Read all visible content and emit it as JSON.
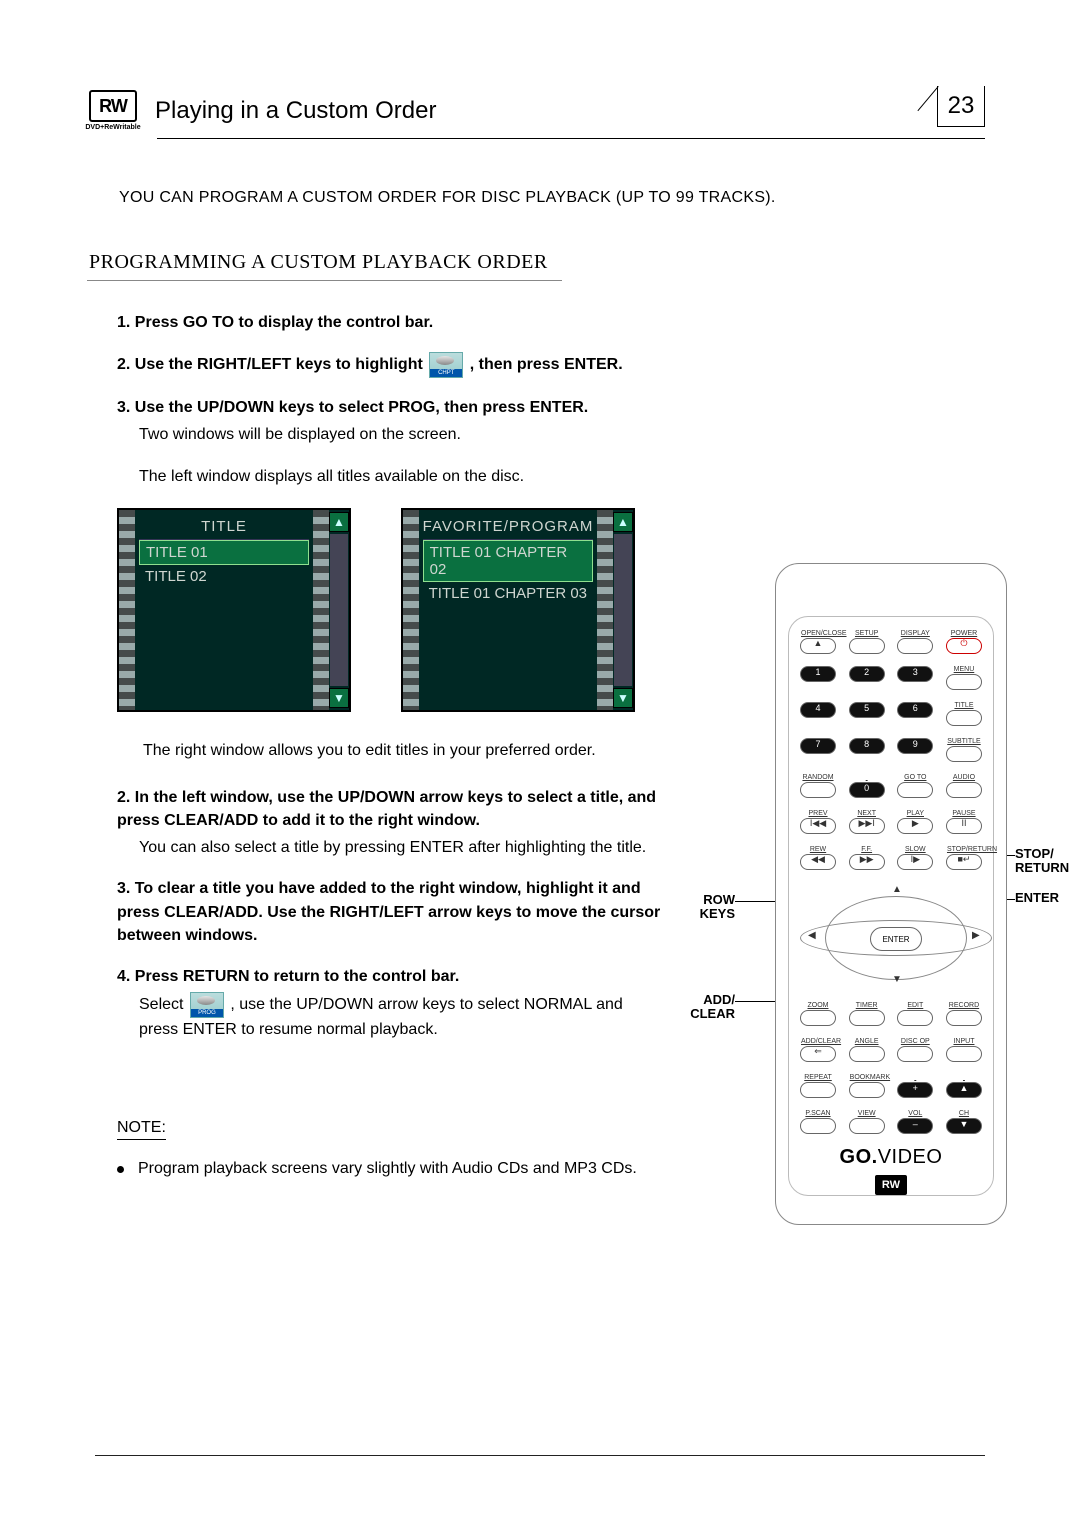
{
  "header": {
    "rw_text": "RW",
    "rw_sub": "DVD+ReWritable",
    "title": "Playing in a Custom Order",
    "page_number": "23"
  },
  "intro": "YOU CAN PROGRAM A CUSTOM ORDER FOR DISC PLAYBACK (UP TO 99 TRACKS).",
  "section_heading": "PROGRAMMING A CUSTOM PLAYBACK ORDER",
  "steps_a": {
    "s1": "1. Press GO TO to display  the control bar.",
    "s2a": "2. Use the RIGHT/LEFT keys to highlight",
    "s2b": ", then press ENTER.",
    "s3a": "3. Use the UP/DOWN keys to select PROG, then press ENTER.",
    "s3b": "Two windows will be displayed on the screen.",
    "caption_left": "The left window displays all titles available on the disc."
  },
  "windows": {
    "left": {
      "title": "TITLE",
      "rows": [
        "TITLE 01",
        "TITLE 02"
      ]
    },
    "right": {
      "title": "FAVORITE/PROGRAM",
      "rows": [
        "TITLE 01 CHAPTER 02",
        "TITLE 01 CHAPTER 03"
      ]
    }
  },
  "caption_right": "The right window allows you to edit titles in your preferred order.",
  "steps_b": {
    "s2a": "2. In the left window, use the UP/DOWN arrow keys to select a title, and press CLEAR/ADD to add it to the right window.",
    "s2b": "You can also select a title by pressing ENTER after highlighting the title.",
    "s3": "3. To clear a title you have added to the right window, highlight it and press CLEAR/ADD. Use the RIGHT/LEFT arrow keys to move the cursor between windows.",
    "s4": "4. Press RETURN to return to the control bar.",
    "s4suba": "Select",
    "s4subb": ", use the UP/DOWN  arrow keys to  select NORMAL and press ENTER to resume normal playback."
  },
  "note": {
    "heading": "NOTE:",
    "body": "Program playback screens vary slightly with Audio CDs and MP3 CDs."
  },
  "inline_icons": {
    "chpt": "CHPT",
    "prog": "PROG"
  },
  "remote": {
    "row1": [
      "OPEN/CLOSE",
      "SETUP",
      "DISPLAY",
      "POWER"
    ],
    "row1sym": [
      "▲",
      "",
      "",
      "⏻"
    ],
    "row2": [
      "1",
      "2",
      "3",
      "MENU"
    ],
    "row3": [
      "4",
      "5",
      "6",
      "TITLE"
    ],
    "row4": [
      "7",
      "8",
      "9",
      "SUBTITLE"
    ],
    "row5": [
      "RANDOM",
      "0",
      "GO TO",
      "AUDIO"
    ],
    "row6": [
      "PREV",
      "NEXT",
      "PLAY",
      "PAUSE"
    ],
    "row6sym": [
      "I◀◀",
      "▶▶I",
      "▶",
      "II"
    ],
    "row7": [
      "REW",
      "F.F.",
      "SLOW",
      "STOP/RETURN"
    ],
    "row7sym": [
      "◀◀",
      "▶▶",
      "I▶",
      "■↵"
    ],
    "enter": "ENTER",
    "row8": [
      "ZOOM",
      "TIMER",
      "EDIT",
      "RECORD"
    ],
    "row9": [
      "ADD/CLEAR",
      "ANGLE",
      "DISC OP",
      "INPUT"
    ],
    "row9sym0": "⇐",
    "row10": [
      "REPEAT",
      "BOOKMARK",
      "+",
      "▲"
    ],
    "row11": [
      "P.SCAN",
      "VIEW",
      "VOL –",
      "CH ▼"
    ],
    "vol": "VOL",
    "ch": "CH",
    "brand": "GO",
    "brand2": "VIDEO",
    "rw": "RW"
  },
  "callouts": {
    "row_keys": "ROW\nKEYS",
    "add_clear": "ADD/\nCLEAR",
    "stop_return": "STOP/\nRETURN",
    "enter": "ENTER"
  }
}
